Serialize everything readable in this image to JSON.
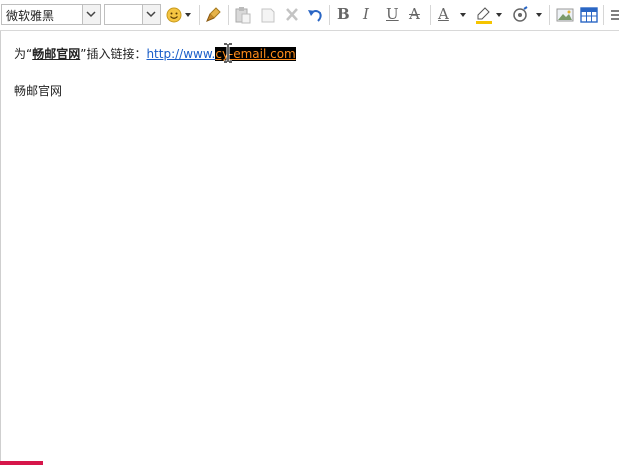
{
  "toolbar": {
    "font_family_value": "微软雅黑",
    "font_size_value": "",
    "icons": [
      "font-family-dropdown",
      "font-size-dropdown",
      "emoji-icon",
      "format-painter-icon",
      "paste-icon",
      "copy-icon",
      "cut-icon",
      "undo-icon",
      "bold-icon",
      "italic-icon",
      "underline-icon",
      "strikethrough-icon",
      "font-color-icon",
      "highlight-color-icon",
      "insert-special-icon",
      "insert-image-icon",
      "insert-table-icon",
      "align-icon"
    ],
    "bold_label": "B",
    "italic_label": "I",
    "underline_label": "U",
    "strike_label": "A",
    "fontcolor_label": "A"
  },
  "editor": {
    "line1_prefix": "为“",
    "line1_bold": "畅邮官网",
    "line1_middle": "”插入链接：",
    "link_plain": "http://www.",
    "link_selected": "cy-email.com",
    "line2": "畅邮官网"
  },
  "colors": {
    "link": "#1a5ec9",
    "selection_bg": "#000000",
    "selection_text": "#ff8c1a",
    "bottom_accent": "#d6164a"
  }
}
